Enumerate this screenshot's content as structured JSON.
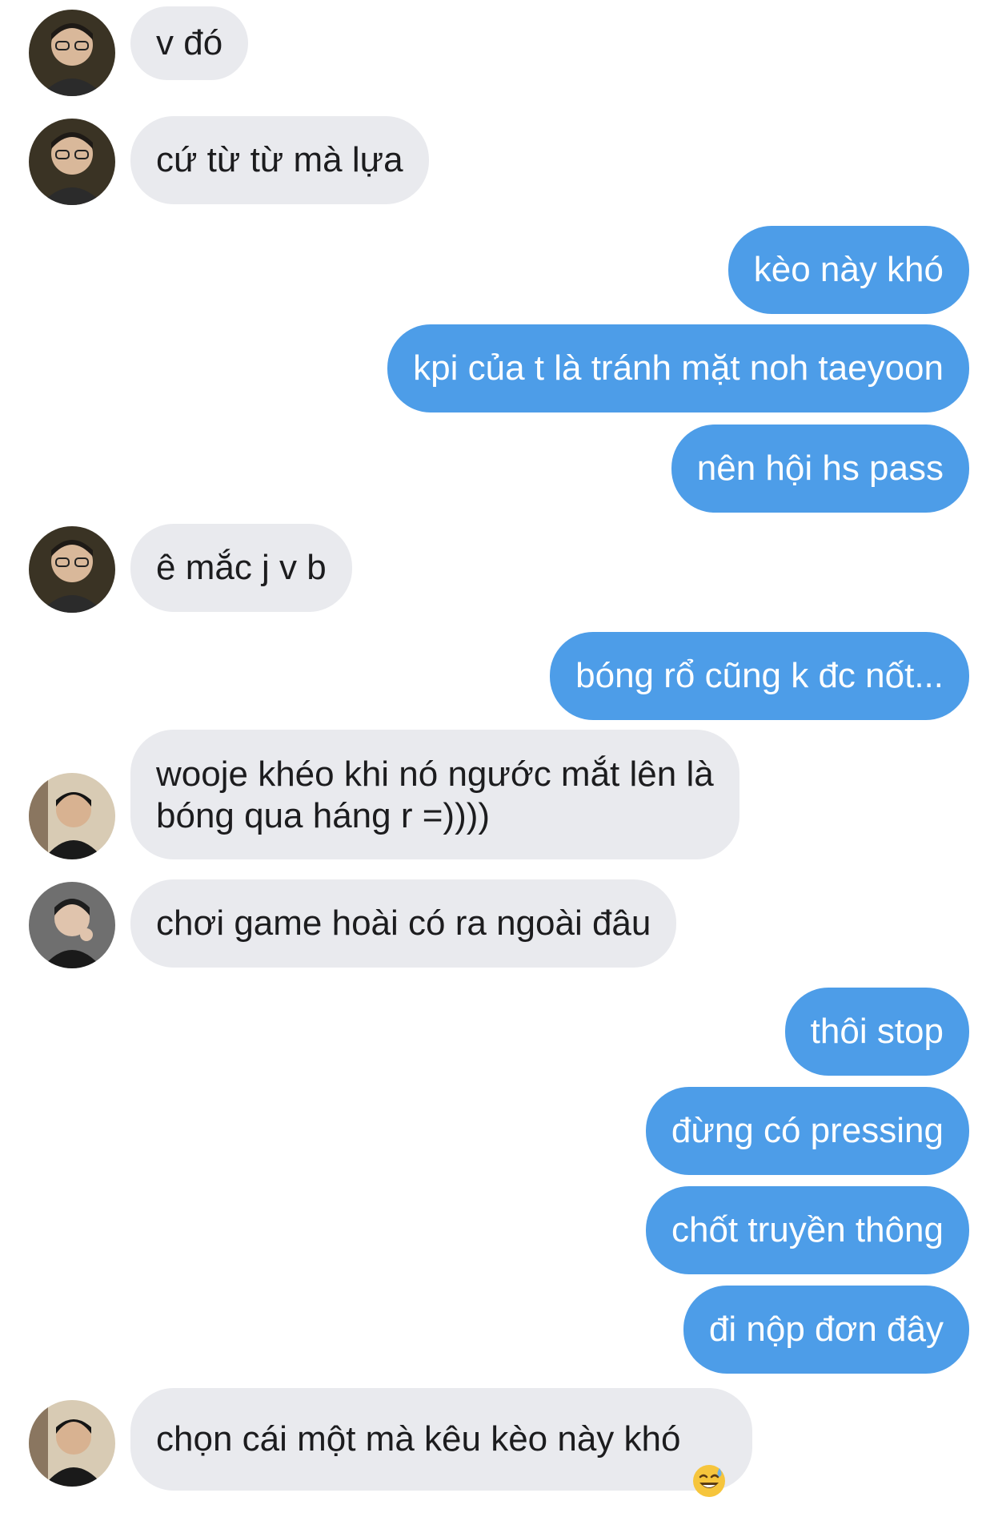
{
  "conversation": {
    "messages": [
      {
        "sender": "friend",
        "avatar": "avatar-a",
        "text": "v đó"
      },
      {
        "sender": "friend",
        "avatar": "avatar-a",
        "text": "cứ từ từ mà lựa"
      },
      {
        "sender": "me",
        "text": "kèo này khó"
      },
      {
        "sender": "me",
        "text": "kpi của t là tránh mặt noh taeyoon"
      },
      {
        "sender": "me",
        "text": "nên hội hs pass"
      },
      {
        "sender": "friend",
        "avatar": "avatar-a",
        "text": "ê mắc j v b"
      },
      {
        "sender": "me",
        "text": "bóng rổ cũng k đc nốt..."
      },
      {
        "sender": "friend",
        "avatar": "avatar-b",
        "text": "wooje khéo khi nó ngước mắt lên là\nbóng qua háng r =))))"
      },
      {
        "sender": "friend",
        "avatar": "avatar-c",
        "text": "chơi game hoài có ra ngoài đâu"
      },
      {
        "sender": "me",
        "text": "thôi stop"
      },
      {
        "sender": "me",
        "text": "đừng có pressing"
      },
      {
        "sender": "me",
        "text": "chốt truyền thông"
      },
      {
        "sender": "me",
        "text": "đi nộp đơn đây"
      },
      {
        "sender": "friend",
        "avatar": "avatar-b",
        "text": "chọn cái một mà kêu kèo này khó",
        "emoji": "sweat-smile-emoji"
      }
    ]
  },
  "colors": {
    "incoming_bubble": "#e9eaee",
    "outgoing_bubble": "#4d9de8",
    "incoming_text": "#1c1c1e",
    "outgoing_text": "#ffffff"
  }
}
